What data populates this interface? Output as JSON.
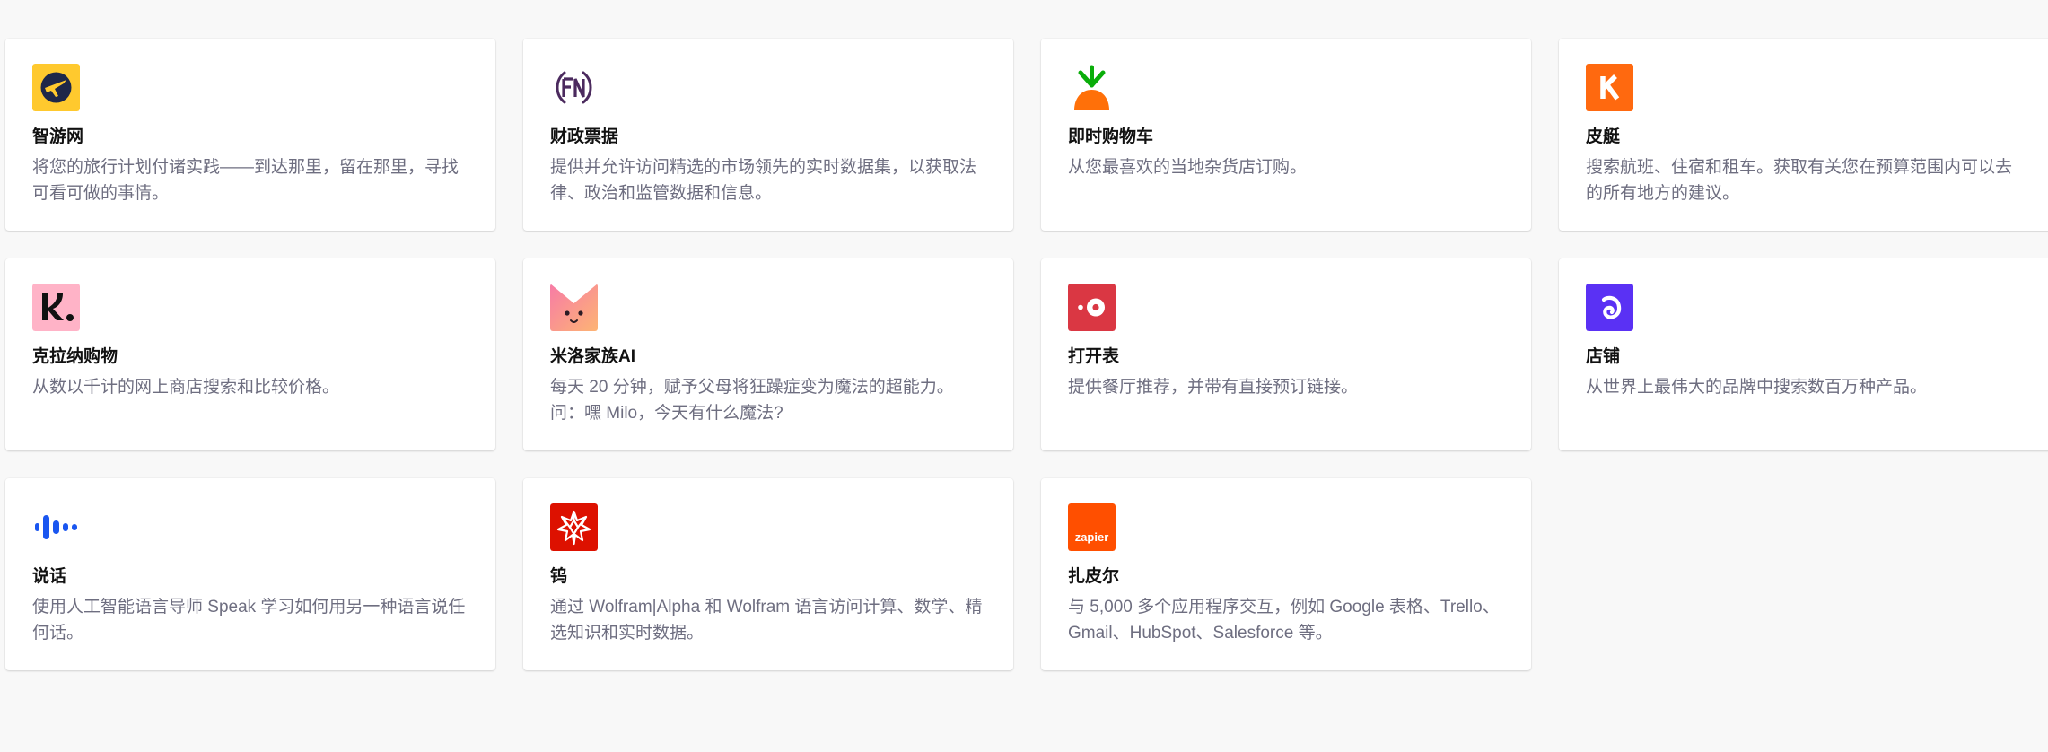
{
  "plugins": [
    {
      "name": "智游网",
      "description": "将您的旅行计划付诸实践——到达那里，留在那里，寻找可看可做的事情。",
      "icon": "airplane-icon",
      "color": "#FFC92E"
    },
    {
      "name": "财政票据",
      "description": "提供并允许访问精选的市场领先的实时数据集，以获取法律、政治和监管数据和信息。",
      "icon": "fn-logo-icon",
      "color": "#4B2A5E"
    },
    {
      "name": "即时购物车",
      "description": "从您最喜欢的当地杂货店订购。",
      "icon": "carrot-icon",
      "color": "#FF7009"
    },
    {
      "name": "皮艇",
      "description": "搜索航班、住宿和租车。获取有关您在预算范围内可以去的所有地方的建议。",
      "icon": "kayak-k-icon",
      "color": "#FF690F"
    },
    {
      "name": "克拉纳购物",
      "description": "从数以千计的网上商店搜索和比较价格。",
      "icon": "klarna-k-icon",
      "color": "#FFB3C7"
    },
    {
      "name": "米洛家族AI",
      "description": "每天 20 分钟，赋予父母将狂躁症变为魔法的超能力。问：嘿 Milo，今天有什么魔法?",
      "icon": "cat-face-icon",
      "color": "#F98FA7"
    },
    {
      "name": "打开表",
      "description": "提供餐厅推荐，并带有直接预订链接。",
      "icon": "opentable-dot-icon",
      "color": "#DA3743"
    },
    {
      "name": "店铺",
      "description": "从世界上最伟大的品牌中搜索数百万种产品。",
      "icon": "shop-swirl-icon",
      "color": "#5A31F4"
    },
    {
      "name": "说话",
      "description": "使用人工智能语言导师 Speak 学习如何用另一种语言说任何话。",
      "icon": "audio-wave-icon",
      "color": "#1A56F0"
    },
    {
      "name": "钨",
      "description": "通过 Wolfram|Alpha 和 Wolfram 语言访问计算、数学、精选知识和实时数据。",
      "icon": "wolfram-star-icon",
      "color": "#DD1100"
    },
    {
      "name": "扎皮尔",
      "description": "与 5,000 多个应用程序交互，例如 Google 表格、Trello、Gmail、HubSpot、Salesforce 等。",
      "icon": "zapier-logo-icon",
      "color": "#FF4F00"
    }
  ],
  "zapier_logo_text": "zapier"
}
